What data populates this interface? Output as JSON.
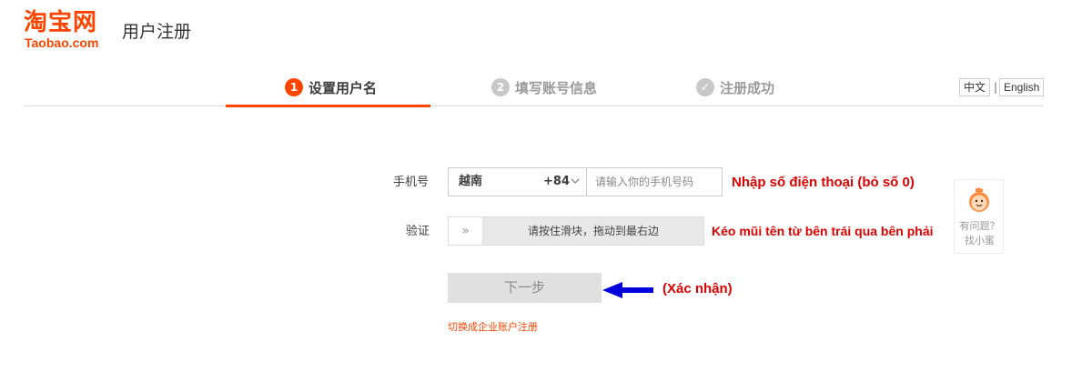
{
  "header": {
    "logo_cn": "淘宝网",
    "logo_en": "Taobao.com",
    "title": "用户注册"
  },
  "steps": [
    {
      "num": "1",
      "label": "设置用户名",
      "state": "active"
    },
    {
      "num": "2",
      "label": "填写账号信息",
      "state": "inactive"
    },
    {
      "num": "✓",
      "label": "注册成功",
      "state": "inactive"
    }
  ],
  "language": {
    "cn": "中文",
    "separator": "|",
    "en": "English"
  },
  "form": {
    "phone_label": "手机号",
    "country": "越南",
    "country_code": "+84",
    "phone_placeholder": "请输入你的手机号码",
    "verify_label": "验证",
    "slider_handle": "»",
    "slider_text": "请按住滑块，拖动到最右边",
    "next_button": "下一步",
    "enterprise_link": "切换成企业账户注册"
  },
  "annotations": {
    "phone": "Nhập số điện thoại (bỏ số 0)",
    "slider": "Kéo mũi tên từ bên trái qua bên phải",
    "confirm": "(Xác nhận)"
  },
  "help": {
    "line1": "有问题？",
    "line2": "找小蜜"
  },
  "icons": {
    "country_chevron": "chevron-down-icon",
    "slider_handle": "double-chevron-right-icon",
    "annotation_arrow": "arrow-left-icon",
    "help_mascot": "mascot-face-icon"
  },
  "colors": {
    "brand": "#ff4400",
    "annotation_red": "#e00000",
    "annotation_blue": "#0000dd"
  }
}
